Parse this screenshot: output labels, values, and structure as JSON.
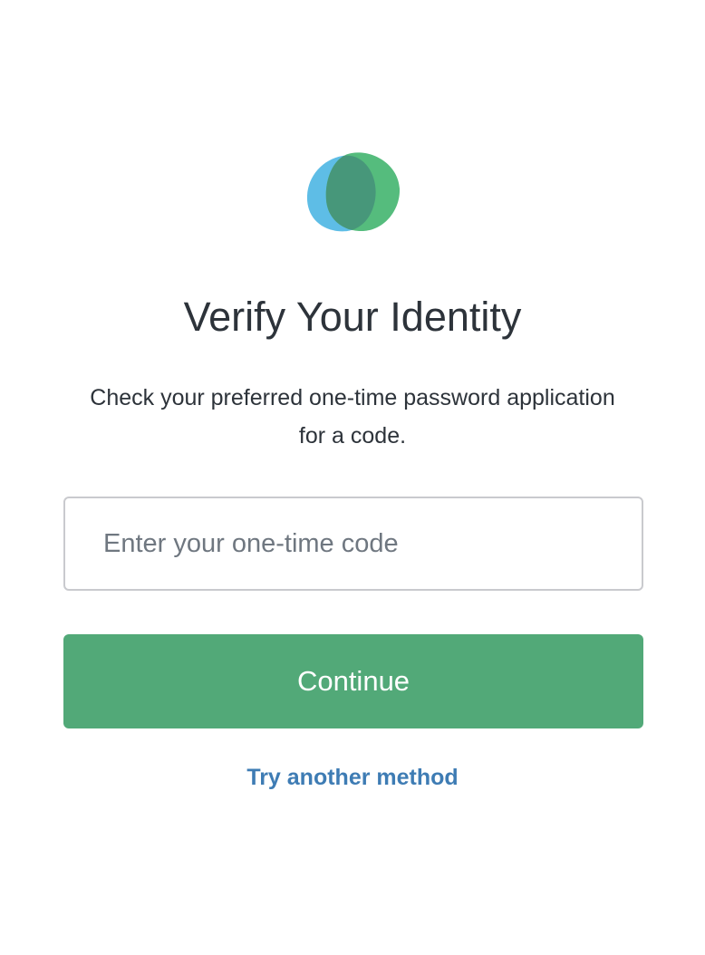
{
  "logo": {
    "icon": "overlapping-blobs-logo",
    "colors": {
      "left_blob": "#5ebde6",
      "right_blob": "#55bc7d",
      "overlap": "#47977a"
    }
  },
  "page_title": "Verify Your Identity",
  "description": "Check your preferred one-time password application for a code.",
  "code_input": {
    "placeholder": "Enter your one-time code",
    "value": ""
  },
  "continue_button": {
    "label": "Continue",
    "background": "#52a978"
  },
  "alt_method_link": {
    "label": "Try another method",
    "color": "#3e7cb4"
  }
}
